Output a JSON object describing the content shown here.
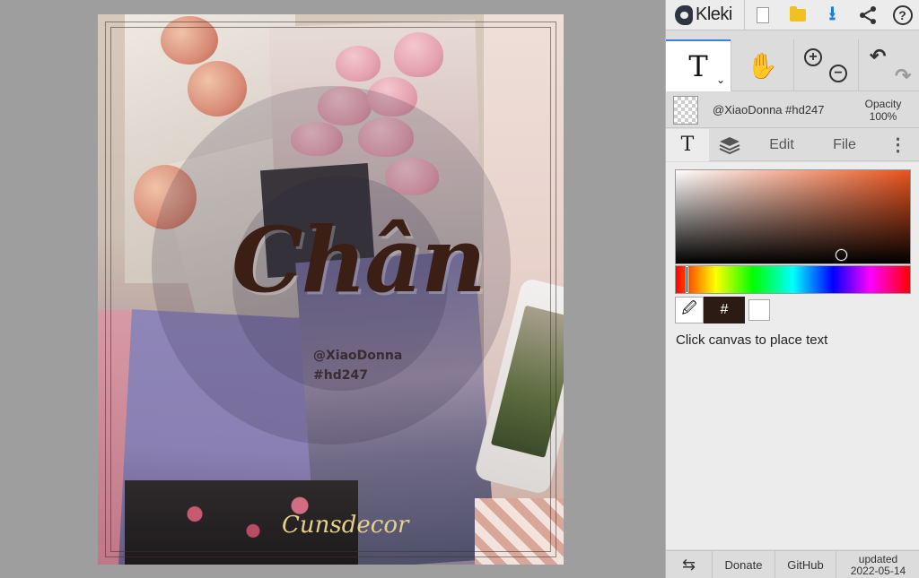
{
  "app": {
    "logo_text": "Kleki"
  },
  "topbar": {
    "icons": [
      "new-document-icon",
      "open-folder-icon",
      "save-download-icon",
      "share-icon",
      "help-icon"
    ],
    "help_symbol": "?"
  },
  "tools": {
    "active_tool_symbol": "T",
    "caret": "⌄",
    "hand_symbol": "✋",
    "zoom_in_symbol": "+",
    "zoom_out_symbol": "−",
    "undo_symbol": "↶",
    "redo_symbol": "↷"
  },
  "layer": {
    "name": "@XiaoDonna #hd247",
    "opacity_label": "Opacity",
    "opacity_value": "100%"
  },
  "tabs": {
    "text_tab": "T",
    "edit": "Edit",
    "file": "File",
    "more": "⋮"
  },
  "color": {
    "primary": "#2b1b14",
    "secondary": "#ffffff",
    "hex_label": "#",
    "eyedropper": "🖉"
  },
  "hint": "Click canvas to place text",
  "footer": {
    "swap_symbol": "⇆",
    "donate": "Donate",
    "github": "GitHub",
    "updated_label": "updated",
    "updated_date": "2022-05-14"
  },
  "canvas": {
    "title": "Chân",
    "handle_line1": "@XiaoDonna",
    "handle_line2": "#hd247",
    "signature": "Cunsdecor"
  }
}
